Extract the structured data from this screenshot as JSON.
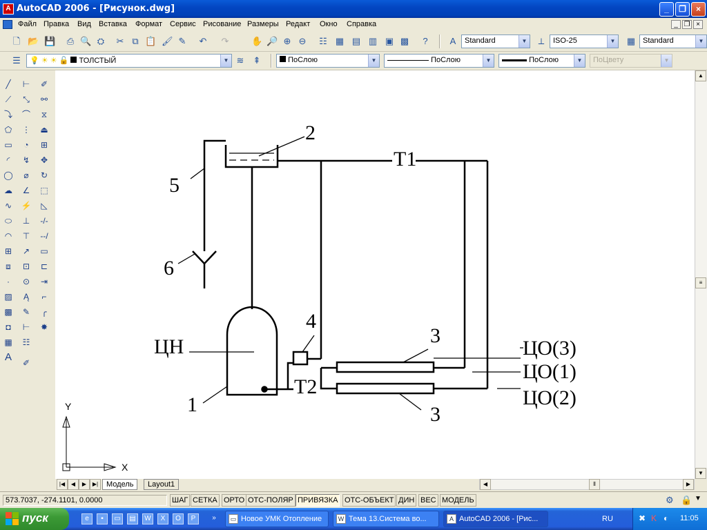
{
  "window": {
    "title": "AutoCAD 2006 - [Рисунок.dwg]"
  },
  "menu": [
    "Файл",
    "Правка",
    "Вид",
    "Вставка",
    "Формат",
    "Сервис",
    "Рисование",
    "Размеры",
    "Редакт",
    "Окно",
    "Справка"
  ],
  "styles_toolbar": {
    "text_style": "Standard",
    "dim_style": "ISO-25",
    "table_style": "Standard"
  },
  "layers_toolbar": {
    "layer": "ТОЛСТЫЙ",
    "color": "ПоСлою",
    "linetype": "ПоСлою",
    "lineweight": "ПоСлою",
    "plotstyle": "ПоЦвету"
  },
  "drawing_labels": {
    "l1": "1",
    "l2": "2",
    "l3a": "3",
    "l3b": "3",
    "l4": "4",
    "l5": "5",
    "l6": "6",
    "t1": "Т1",
    "t2": "Т2",
    "cn": "ЦН",
    "co3": "ЦО(3)",
    "co1": "ЦО(1)",
    "co2": "ЦО(2)",
    "ucs_x": "X",
    "ucs_y": "Y"
  },
  "layout_tabs": [
    "Модель",
    "Layout1"
  ],
  "status": {
    "coords": "573.7037, -274.1101, 0.0000",
    "toggles": [
      "ШАГ",
      "СЕТКА",
      "ОРТО",
      "ОТС-ПОЛЯР",
      "ПРИВЯЗКА",
      "ОТС-ОБЪЕКТ",
      "ДИН",
      "ВЕС",
      "МОДЕЛЬ"
    ]
  },
  "taskbar": {
    "start": "пуск",
    "items": [
      "Новое УМК Отопление",
      "Тема 13.Система во...",
      "AutoCAD 2006 - [Рис..."
    ],
    "lang": "RU",
    "clock": "11:05"
  },
  "colors": {
    "titlebar": "#0346c2",
    "taskbar": "#245edb",
    "start": "#3c9a36",
    "drawing_bg": "#ffffff"
  }
}
